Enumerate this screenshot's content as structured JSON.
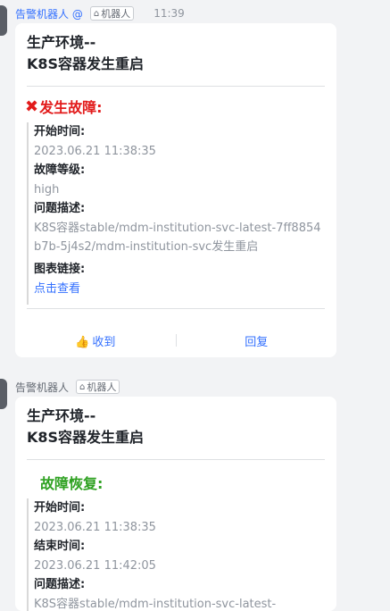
{
  "messages": [
    {
      "sender": "告警机器人 @",
      "bot_tag": "机器人",
      "time": "11:39",
      "card": {
        "title_line1": "生产环境--",
        "title_line2": "K8S容器发生重启",
        "section_title": "发生故障:",
        "section_icon": "red-x-icon",
        "fields": [
          {
            "label": "开始时间:",
            "value": "2023.06.21 11:38:35"
          },
          {
            "label": "故障等级:",
            "value": "high"
          },
          {
            "label": "问题描述:",
            "value": "K8S容器stable/mdm-institution-svc-latest-7ff8854b7b-5j4s2/mdm-institution-svc发生重启"
          }
        ],
        "link_label": "图表链接:",
        "link_text": "点击查看",
        "actions": {
          "ack": "收到",
          "reply": "回复"
        }
      }
    },
    {
      "sender": "告警机器人",
      "bot_tag": "机器人",
      "card": {
        "title_line1": "生产环境--",
        "title_line2": "K8S容器发生重启",
        "section_title": "故障恢复:",
        "fields": [
          {
            "label": "开始时间:",
            "value": "2023.06.21 11:38:35"
          },
          {
            "label": "结束时间:",
            "value": "2023.06.21 11:42:05"
          },
          {
            "label": "问题描述:",
            "value": "K8S容器stable/mdm-institution-svc-latest-"
          }
        ]
      }
    }
  ],
  "colors": {
    "link": "#3370ff",
    "fault": "#e21b1b",
    "recovery": "#2ea121",
    "muted": "#8f959e"
  }
}
